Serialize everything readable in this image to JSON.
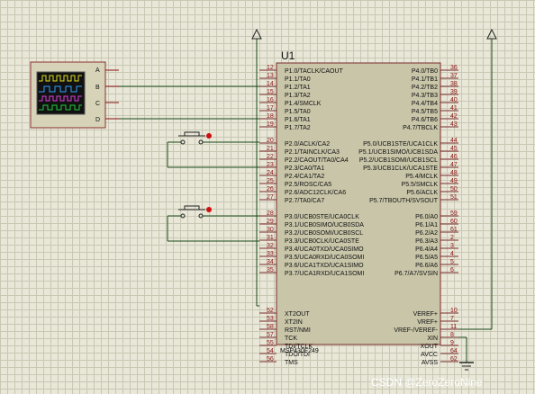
{
  "schematic": {
    "title": "U1",
    "part_number": "MSP430F249",
    "watermark": "CSDN @ZeroZeroNine",
    "oscilloscope": {
      "channels": [
        "A",
        "B",
        "C",
        "D"
      ]
    },
    "left_pins": [
      {
        "num": "12",
        "label": "P1.0/TACLK/CAOUT"
      },
      {
        "num": "13",
        "label": "P1.1/TA0"
      },
      {
        "num": "14",
        "label": "P1.2/TA1"
      },
      {
        "num": "15",
        "label": "P1.3/TA2"
      },
      {
        "num": "16",
        "label": "P1.4/SMCLK"
      },
      {
        "num": "17",
        "label": "P1.5/TA0"
      },
      {
        "num": "18",
        "label": "P1.6/TA1"
      },
      {
        "num": "19",
        "label": "P1.7/TA2"
      },
      {
        "num": "20",
        "label": "P2.0/ACLK/CA2"
      },
      {
        "num": "21",
        "label": "P2.1/TAINCLK/CA3"
      },
      {
        "num": "22",
        "label": "P2.2/CAOUT/TA0/CA4"
      },
      {
        "num": "23",
        "label": "P2.3/CA0/TA1"
      },
      {
        "num": "24",
        "label": "P2.4/CA1/TA2"
      },
      {
        "num": "25",
        "label": "P2.5/ROSC/CA5"
      },
      {
        "num": "26",
        "label": "P2.6/ADC12CLK/CA6"
      },
      {
        "num": "27",
        "label": "P2.7/TA0/CA7"
      },
      {
        "num": "28",
        "label": "P3.0/UCB0STE/UCA0CLK"
      },
      {
        "num": "29",
        "label": "P3.1/UCB0SIMO/UCB0SDA"
      },
      {
        "num": "30",
        "label": "P3.2/UCB0SOMI/UCB0SCL"
      },
      {
        "num": "31",
        "label": "P3.3/UCB0CLK/UCA0STE"
      },
      {
        "num": "32",
        "label": "P3.4/UCA0TXD/UCA0SIMO"
      },
      {
        "num": "33",
        "label": "P3.5/UCA0RXD/UCA0SOMI"
      },
      {
        "num": "34",
        "label": "P3.6/UCA1TXD/UCA1SIMO"
      },
      {
        "num": "35",
        "label": "P3.7/UCA1RXD/UCA1SOMI"
      },
      {
        "num": "52",
        "label": "XT2OUT"
      },
      {
        "num": "53",
        "label": "XT2IN"
      },
      {
        "num": "58",
        "label": "RST/NMI"
      },
      {
        "num": "57",
        "label": "TCK"
      },
      {
        "num": "55",
        "label": "TDI/TCLK"
      },
      {
        "num": "54",
        "label": "TDO/TDI"
      },
      {
        "num": "56",
        "label": "TMS"
      }
    ],
    "right_pins": [
      {
        "num": "36",
        "label": "P4.0/TB0"
      },
      {
        "num": "37",
        "label": "P4.1/TB1"
      },
      {
        "num": "38",
        "label": "P4.2/TB2"
      },
      {
        "num": "39",
        "label": "P4.3/TB3"
      },
      {
        "num": "40",
        "label": "P4.4/TB4"
      },
      {
        "num": "41",
        "label": "P4.5/TB5"
      },
      {
        "num": "42",
        "label": "P4.6/TB6"
      },
      {
        "num": "43",
        "label": "P4.7/TBCLK"
      },
      {
        "num": "44",
        "label": "P5.0/UCB1STE/UCA1CLK"
      },
      {
        "num": "45",
        "label": "P5.1/UCB1SIMO/UCB1SDA"
      },
      {
        "num": "46",
        "label": "P5.2/UCB1SOMI/UCB1SCL"
      },
      {
        "num": "47",
        "label": "P5.3/UCB1CLK/UCA1STE"
      },
      {
        "num": "48",
        "label": "P5.4/MCLK"
      },
      {
        "num": "49",
        "label": "P5.5/SMCLK"
      },
      {
        "num": "50",
        "label": "P5.6/ACLK"
      },
      {
        "num": "51",
        "label": "P5.7/TBOUTH/SVSOUT"
      },
      {
        "num": "59",
        "label": "P6.0/A0"
      },
      {
        "num": "60",
        "label": "P6.1/A1"
      },
      {
        "num": "61",
        "label": "P6.2/A2"
      },
      {
        "num": "2",
        "label": "P6.3/A3"
      },
      {
        "num": "3",
        "label": "P6.4/A4"
      },
      {
        "num": "4",
        "label": "P6.5/A5"
      },
      {
        "num": "5",
        "label": "P6.6/A6"
      },
      {
        "num": "6",
        "label": "P6.7/A7/SVSIN"
      },
      {
        "num": "10",
        "label": "VEREF+"
      },
      {
        "num": "7",
        "label": "VREF+"
      },
      {
        "num": "11",
        "label": "VREF-/VEREF-"
      },
      {
        "num": "8",
        "label": "XIN"
      },
      {
        "num": "9",
        "label": "XOUT"
      },
      {
        "num": "64",
        "label": "AVCC"
      },
      {
        "num": "62",
        "label": "AVSS"
      }
    ]
  }
}
